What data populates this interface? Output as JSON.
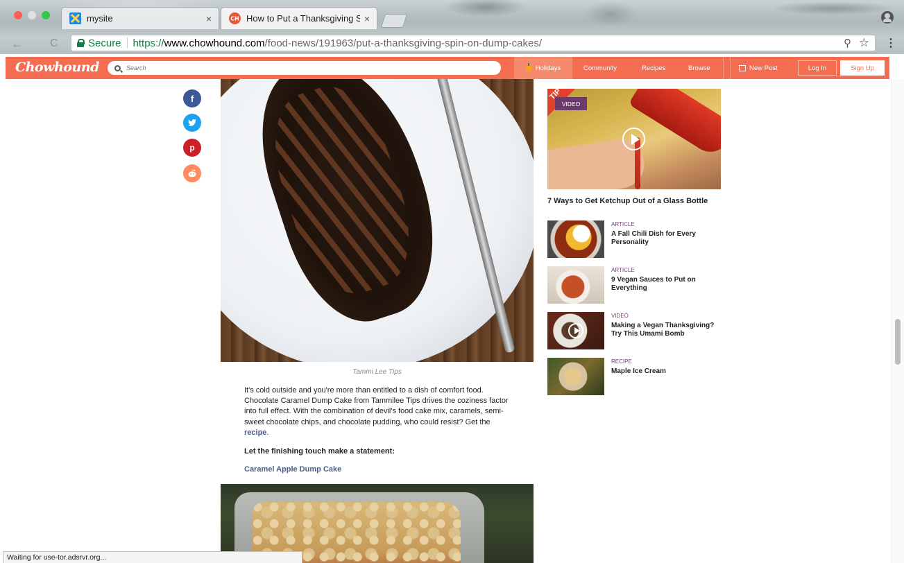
{
  "browser": {
    "tabs": [
      {
        "title": "mysite",
        "active": false
      },
      {
        "title": "How to Put a Thanksgiving Spi",
        "active": true
      }
    ],
    "address": {
      "secure_label": "Secure",
      "scheme": "https://",
      "host": "www.chowhound.com",
      "path": "/food-news/191963/put-a-thanksgiving-spin-on-dump-cakes/"
    },
    "status": "Waiting for use-tor.adsrvr.org..."
  },
  "site": {
    "logo": "Chowhound",
    "search_placeholder": "Search",
    "nav": {
      "holidays": "Holidays",
      "community": "Community",
      "recipes": "Recipes",
      "browse": "Browse",
      "new_post": "New Post",
      "login": "Log In",
      "signup": "Sign Up"
    },
    "accent_color": "#f46d51"
  },
  "share": {
    "facebook": "f",
    "twitter": "t",
    "pinterest": "p",
    "reddit": "r"
  },
  "article": {
    "image_credit": "Tammi Lee Tips",
    "paragraph": "It's cold outside and you're more than entitled to a dish of comfort food. Chocolate Caramel Dump Cake from Tammilee Tips drives the coziness factor into full effect. With the combination of devil's food cake mix, caramels, semi-sweet chocolate chips, and chocolate pudding, who could resist? Get the ",
    "recipe_link": "recipe",
    "period": ".",
    "statement": "Let the finishing touch make a statement:",
    "next_link": "Caramel Apple Dump Cake"
  },
  "sidebar": {
    "video": {
      "badge": "VIDEO",
      "corner_text": "TIP",
      "title": "7 Ways to Get Ketchup Out of a Glass Bottle"
    },
    "items": [
      {
        "type": "ARTICLE",
        "title": "A Fall Chili Dish for Every Personality"
      },
      {
        "type": "ARTICLE",
        "title": "9 Vegan Sauces to Put on Everything"
      },
      {
        "type": "VIDEO",
        "title": "Making a Vegan Thanksgiving? Try This Umami Bomb"
      },
      {
        "type": "RECIPE",
        "title": "Maple Ice Cream"
      }
    ]
  }
}
